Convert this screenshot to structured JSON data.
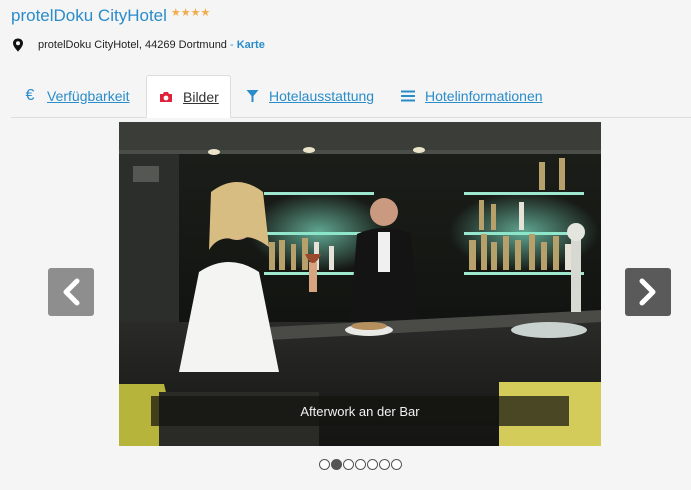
{
  "hotel": {
    "name": "protelDoku CityHotel",
    "stars": "★★★★",
    "address": "protelDoku CityHotel, 44269 Dortmund",
    "separator": " - ",
    "map_link": "Karte"
  },
  "tabs": [
    {
      "label": "Verfügbarkeit",
      "icon": "euro-icon"
    },
    {
      "label": "Bilder",
      "icon": "camera-icon",
      "active": true
    },
    {
      "label": "Hotelausstattung",
      "icon": "filter-glass-icon"
    },
    {
      "label": "Hotelinformationen",
      "icon": "list-icon"
    }
  ],
  "gallery": {
    "caption": "Afterwork an der Bar",
    "current_slide": 2,
    "total_slides": 7
  },
  "colors": {
    "link": "#2a8cc9",
    "star": "#f0ad4e"
  }
}
